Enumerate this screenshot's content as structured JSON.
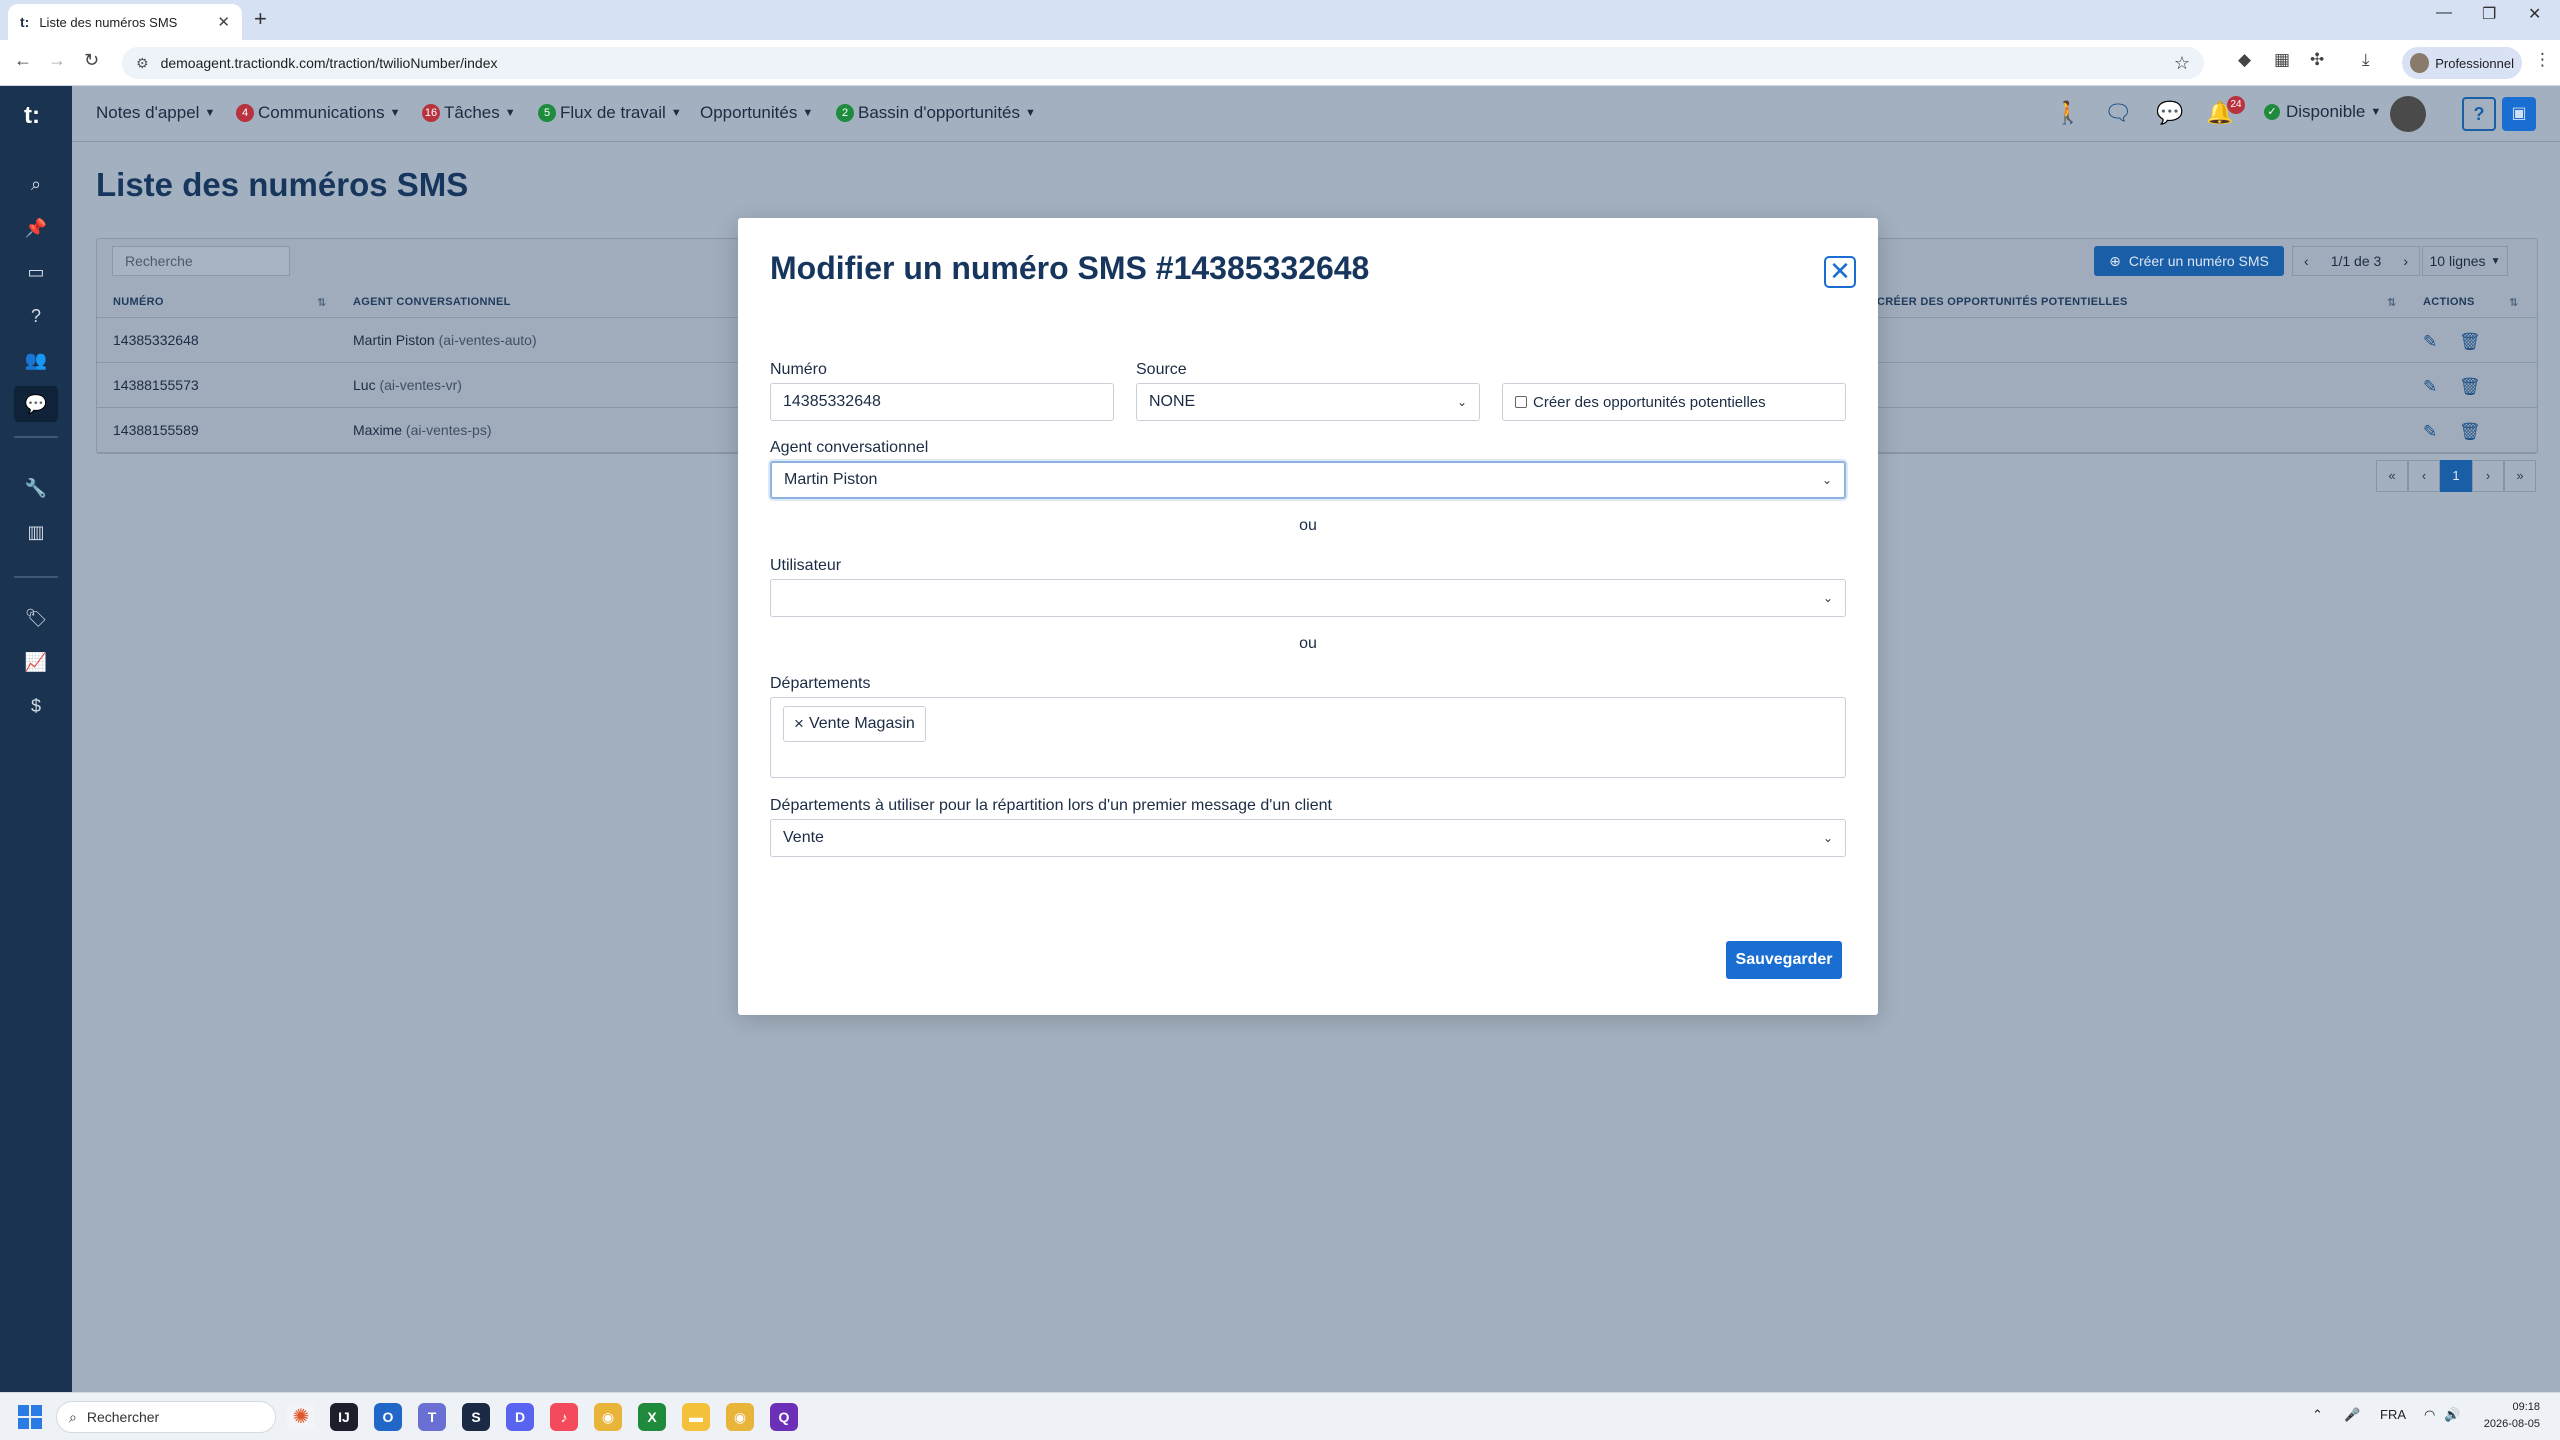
{
  "browser": {
    "tab_title": "Liste des numéros SMS",
    "tab_favicon": "t:",
    "url": "demoagent.tractiondk.com/traction/twilioNumber/index",
    "profile_label": "Professionnel"
  },
  "sidebar": {
    "logo": "t:",
    "items": [
      "search",
      "pin",
      "monitor",
      "help-circle",
      "users",
      "chat",
      "wrench",
      "board",
      "tag",
      "chart",
      "dollar"
    ]
  },
  "topnav": {
    "menus": [
      {
        "label": "Notes d'appel",
        "badge": ""
      },
      {
        "label": "Communications",
        "badge": "4",
        "badge_color": "#b8333f"
      },
      {
        "label": "Tâches",
        "badge": "16",
        "badge_color": "#b8333f"
      },
      {
        "label": "Flux de travail",
        "badge": "5",
        "badge_color": "#1f8b3d"
      },
      {
        "label": "Opportunités",
        "badge": ""
      },
      {
        "label": "Bassin d'opportunités",
        "badge": "2",
        "badge_color": "#1f8b3d"
      }
    ],
    "notifications_count": "24",
    "status": "Disponible",
    "help_label": "?"
  },
  "page": {
    "title": "Liste des numéros SMS",
    "search_placeholder": "Recherche",
    "create_button": "Créer un numéro SMS",
    "pager_label": "1/1 de 3",
    "lines_label": "10 lignes",
    "columns": {
      "number": "NUMÉRO",
      "agent": "AGENT CONVERSATIONNEL",
      "create_opps": "CRÉER DES OPPORTUNITÉS POTENTIELLES",
      "actions": "ACTIONS"
    },
    "rows": [
      {
        "number": "14385332648",
        "agent": "Martin Piston",
        "agent_id": "(ai-ventes-auto)"
      },
      {
        "number": "14388155573",
        "agent": "Luc",
        "agent_id": "(ai-ventes-vr)"
      },
      {
        "number": "14388155589",
        "agent": "Maxime",
        "agent_id": "(ai-ventes-ps)"
      }
    ],
    "pagination": {
      "first": "«",
      "prev": "‹",
      "current": "1",
      "next": "›",
      "last": "»"
    }
  },
  "modal": {
    "title": "Modifier un numéro SMS #14385332648",
    "numero_label": "Numéro",
    "numero_value": "14385332648",
    "source_label": "Source",
    "source_value": "NONE",
    "create_opps_checkbox": "Créer des opportunités potentielles",
    "create_opps_checked": false,
    "agent_label": "Agent conversationnel",
    "agent_value": "Martin Piston",
    "or_1": "ou",
    "user_label": "Utilisateur",
    "user_value": "",
    "or_2": "ou",
    "departments_label": "Départements",
    "department_tags": [
      "Vente Magasin"
    ],
    "routing_label": "Départements à utiliser pour la répartition lors d'un premier message d'un client",
    "routing_value": "Vente",
    "save_button": "Sauvegarder"
  },
  "taskbar": {
    "search_placeholder": "Rechercher",
    "language": "FRA",
    "time": "09:18",
    "date": "2026-08-05"
  },
  "colors": {
    "primary": "#1a6ed1",
    "navy": "#17365d",
    "sidebar": "#1a3350",
    "overlay_bg": "#a3b0bf"
  }
}
